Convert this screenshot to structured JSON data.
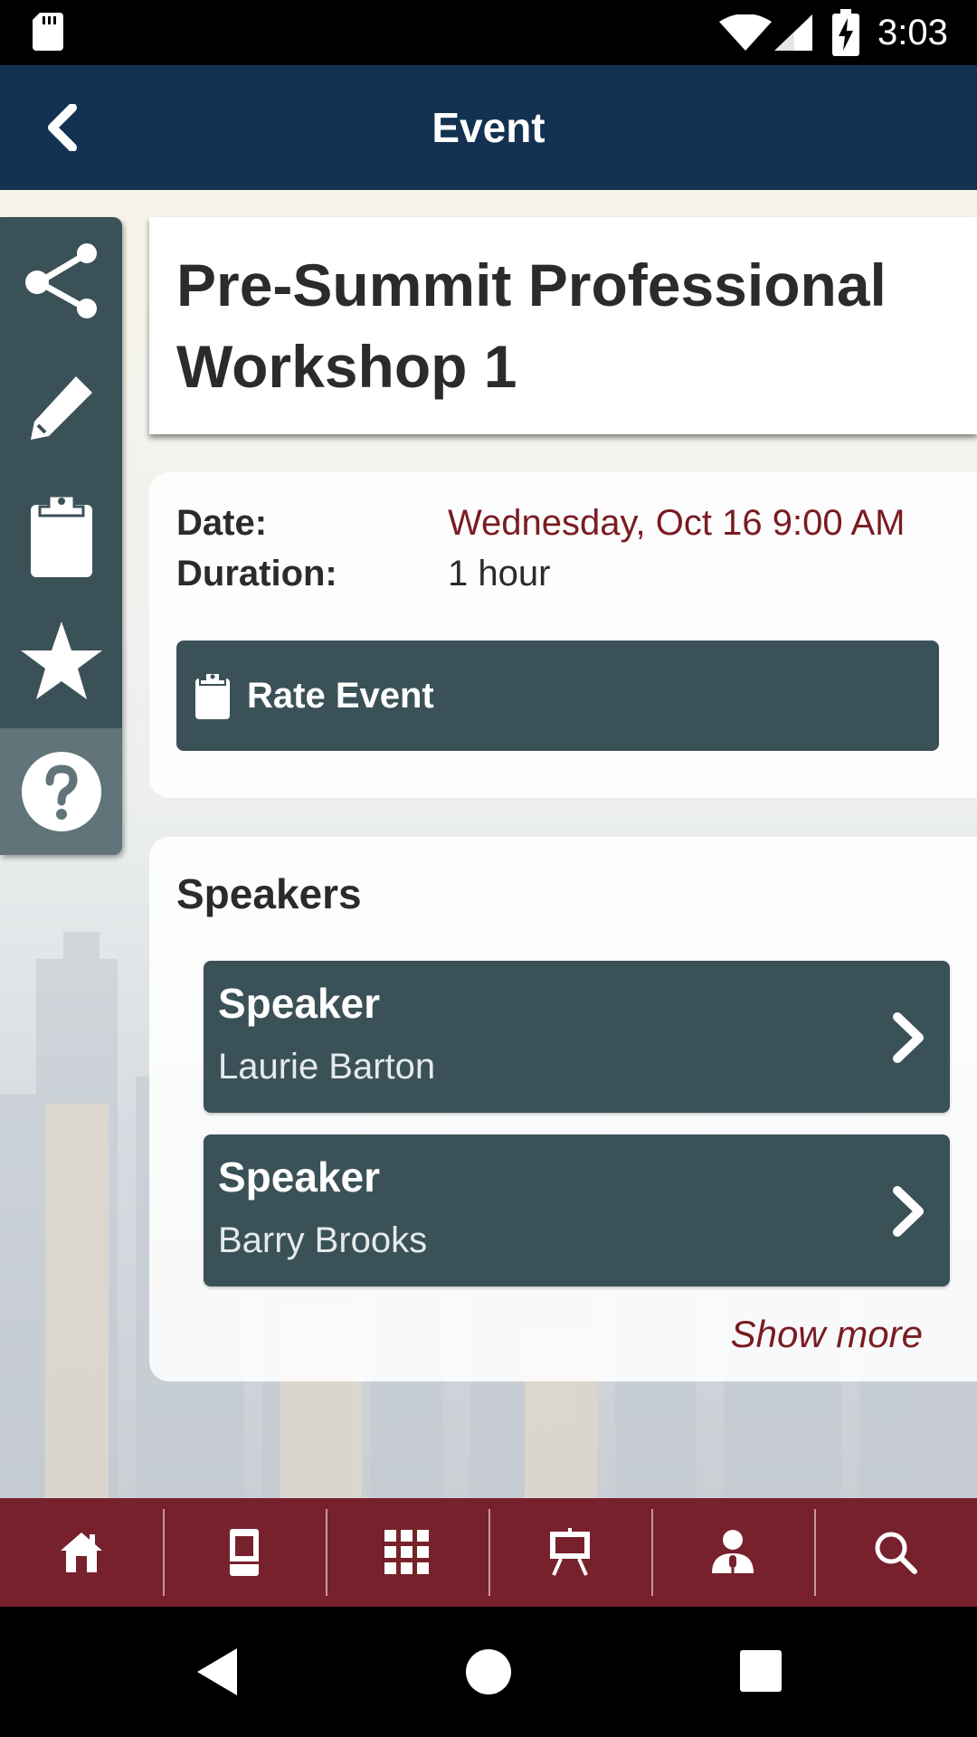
{
  "status_bar": {
    "time": "3:03",
    "icons": [
      "sd-card-icon",
      "wifi-icon",
      "signal-icon",
      "battery-charging-icon"
    ]
  },
  "app_bar": {
    "title": "Event",
    "back_icon": "chevron-left-icon"
  },
  "side_rail": {
    "items": [
      {
        "icon": "share-icon"
      },
      {
        "icon": "pencil-icon"
      },
      {
        "icon": "clipboard-icon"
      },
      {
        "icon": "star-icon"
      },
      {
        "icon": "help-icon"
      }
    ]
  },
  "event": {
    "title": "Pre-Summit Professional Workshop 1",
    "date_label": "Date:",
    "date_value": "Wednesday, Oct 16 9:00 AM",
    "duration_label": "Duration:",
    "duration_value": "1 hour",
    "rate_button_label": "Rate Event",
    "rate_button_icon": "clipboard-icon"
  },
  "speakers": {
    "heading": "Speakers",
    "items": [
      {
        "role": "Speaker",
        "name": "Laurie Barton"
      },
      {
        "role": "Speaker",
        "name": "Barry Brooks"
      }
    ],
    "show_more": "Show more"
  },
  "bottom_nav": {
    "items": [
      {
        "icon": "home-icon"
      },
      {
        "icon": "booth-icon"
      },
      {
        "icon": "floor-plan-icon"
      },
      {
        "icon": "presentation-icon"
      },
      {
        "icon": "speaker-icon"
      },
      {
        "icon": "search-icon"
      }
    ]
  },
  "colors": {
    "app_bar": "#133252",
    "rail": "#3b5158",
    "accent_red": "#7a1c22",
    "bottom_nav": "#77212c"
  }
}
